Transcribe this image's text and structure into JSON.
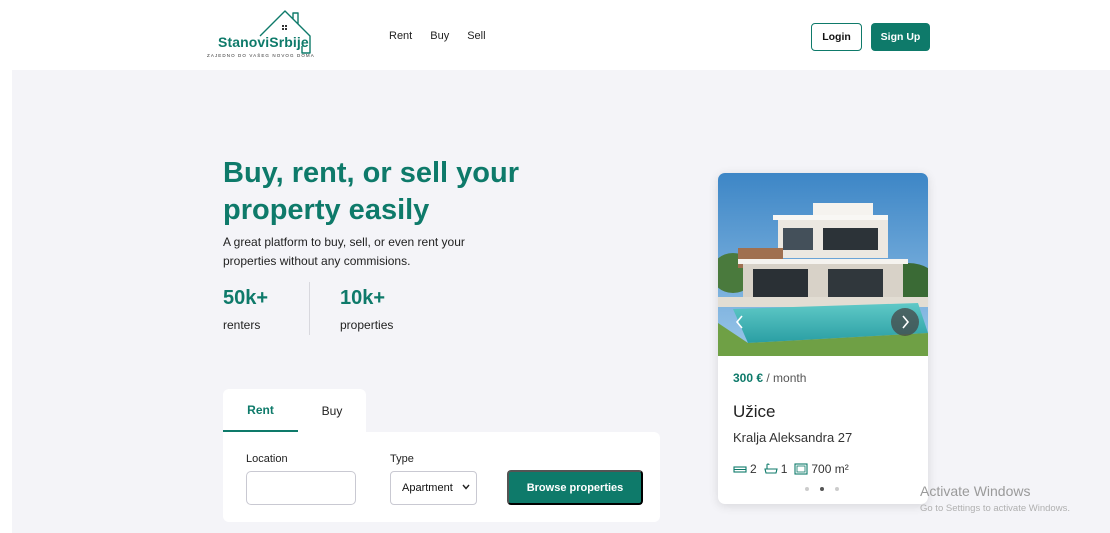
{
  "brand": {
    "name": "StanoviSrbije",
    "tagline": "ZAJEDNO DO VAŠEG NOVOG DOMA",
    "color": "#0e7a6a"
  },
  "nav": {
    "items": [
      {
        "label": "Rent"
      },
      {
        "label": "Buy"
      },
      {
        "label": "Sell"
      }
    ]
  },
  "auth": {
    "login_label": "Login",
    "signup_label": "Sign Up"
  },
  "hero": {
    "title": "Buy, rent, or sell your property easily",
    "description": "A great platform to buy, sell, or even rent your properties without any commisions.",
    "stats": [
      {
        "value": "50k+",
        "label": "renters"
      },
      {
        "value": "10k+",
        "label": "properties"
      }
    ]
  },
  "search": {
    "tabs": [
      {
        "label": "Rent",
        "active": true
      },
      {
        "label": "Buy",
        "active": false
      }
    ],
    "location_label": "Location",
    "location_value": "",
    "type_label": "Type",
    "type_value": "Apartment",
    "browse_label": "Browse properties"
  },
  "listing": {
    "price": "300 €",
    "period": "/ month",
    "city": "Užice",
    "address": "Kralja Aleksandra 27",
    "bedrooms": "2",
    "bathrooms": "1",
    "area": "700 m²",
    "slide_count": 3,
    "active_slide": 2
  },
  "watermark": {
    "title": "Activate Windows",
    "subtitle": "Go to Settings to activate Windows."
  }
}
